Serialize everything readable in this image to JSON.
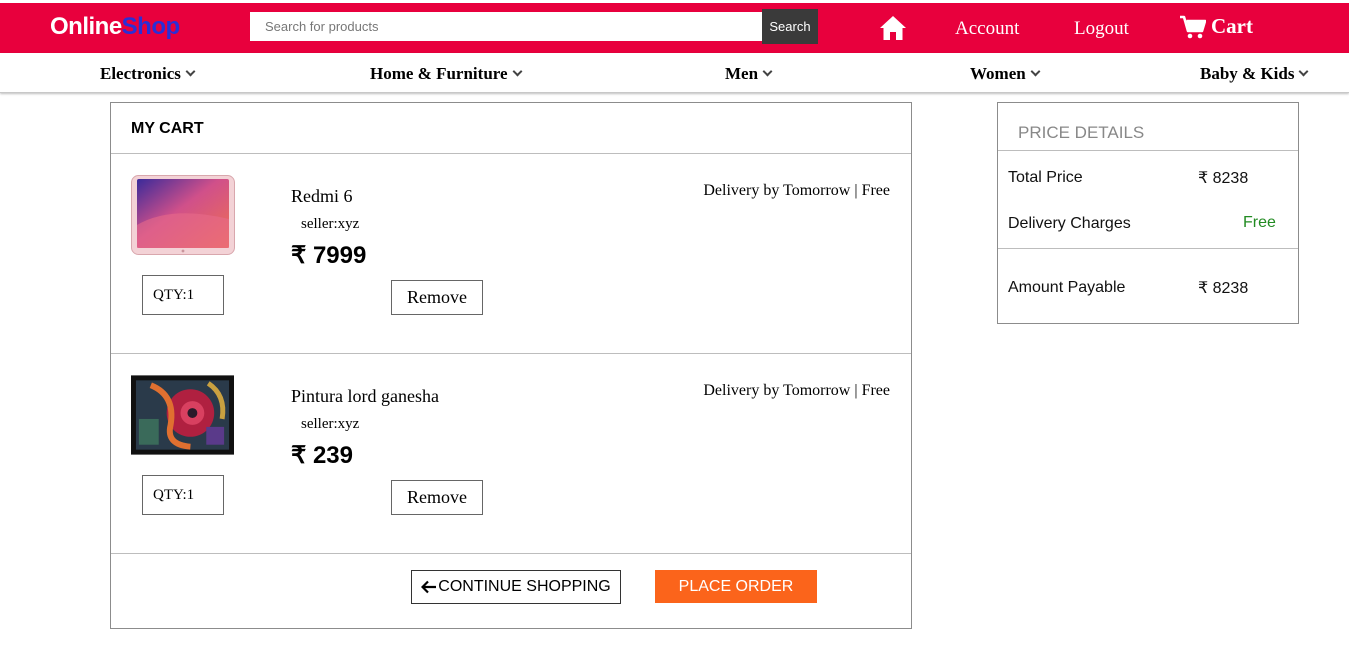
{
  "header": {
    "logo_part1": "Online",
    "logo_part2": "Shop",
    "search_placeholder": "Search for products",
    "search_button": "Search",
    "account_label": "Account",
    "logout_label": "Logout",
    "cart_label": "Cart",
    "brand_color": "#e8003d",
    "home_icon": "home-icon",
    "cart_icon": "shopping-cart-icon"
  },
  "categories": [
    {
      "label": "Electronics"
    },
    {
      "label": "Home & Furniture"
    },
    {
      "label": "Men"
    },
    {
      "label": "Women"
    },
    {
      "label": "Baby & Kids"
    }
  ],
  "cart": {
    "title": "MY CART",
    "items": [
      {
        "name": "Redmi 6",
        "seller": "seller:xyz",
        "price": "₹ 7999",
        "qty": "QTY:1",
        "remove_label": "Remove",
        "delivery": "Delivery by Tomorrow | Free",
        "image_icon": "phone-product-image"
      },
      {
        "name": "Pintura lord ganesha",
        "seller": "seller:xyz",
        "price": "₹ 239",
        "qty": "QTY:1",
        "remove_label": "Remove",
        "delivery": "Delivery by Tomorrow | Free",
        "image_icon": "painting-product-image"
      }
    ],
    "continue_label": "CONTINUE SHOPPING",
    "place_order_label": "PLACE ORDER",
    "place_order_color": "#fb641b"
  },
  "price_details": {
    "title": "PRICE DETAILS",
    "total_label": "Total Price",
    "total_value": "₹ 8238",
    "delivery_label": "Delivery Charges",
    "delivery_value": "Free",
    "payable_label": "Amount Payable",
    "payable_value": "₹ 8238"
  }
}
